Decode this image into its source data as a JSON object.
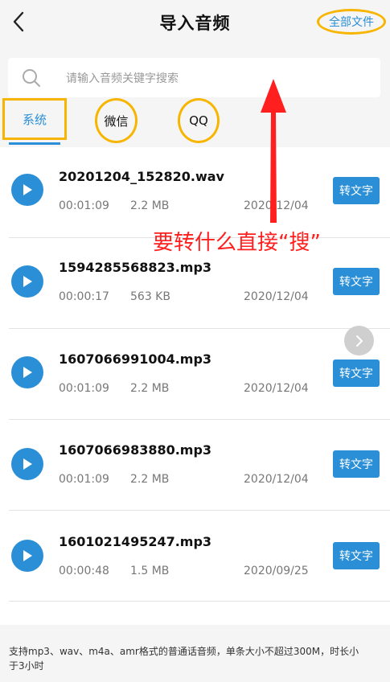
{
  "header": {
    "title": "导入音频",
    "all_files_label": "全部文件"
  },
  "search": {
    "placeholder": "请输入音频关键字搜索"
  },
  "tabs": [
    {
      "label": "系统"
    },
    {
      "label": "微信"
    },
    {
      "label": "QQ"
    }
  ],
  "files": [
    {
      "name": "20201204_152820.wav",
      "duration": "00:01:09",
      "size": "2.2 MB",
      "date": "2020/12/04",
      "action": "转文字"
    },
    {
      "name": "1594285568823.mp3",
      "duration": "00:00:17",
      "size": "563 KB",
      "date": "2020/12/04",
      "action": "转文字"
    },
    {
      "name": "1607066991004.mp3",
      "duration": "00:01:09",
      "size": "2.2 MB",
      "date": "2020/12/04",
      "action": "转文字"
    },
    {
      "name": "1607066983880.mp3",
      "duration": "00:01:09",
      "size": "2.2 MB",
      "date": "2020/12/04",
      "action": "转文字"
    },
    {
      "name": "1601021495247.mp3",
      "duration": "00:00:48",
      "size": "1.5 MB",
      "date": "2020/09/25",
      "action": "转文字"
    }
  ],
  "annotation": {
    "text": "要转什么直接“搜”",
    "color": "#ff1f1f"
  },
  "footer": {
    "note": "支持mp3、wav、m4a、amr格式的普通话音频，单条大小不超过300M，时长小于3小时"
  },
  "colors": {
    "accent": "#2a8fd6",
    "highlight": "#f7b500"
  }
}
